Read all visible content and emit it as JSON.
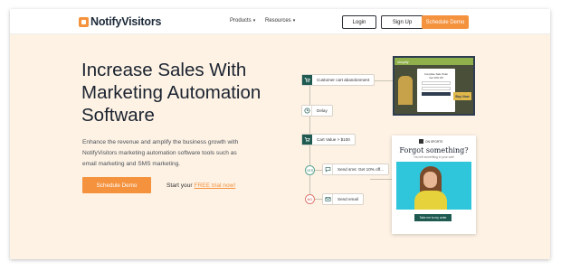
{
  "nav": {
    "brand": "NotifyVisitors",
    "products": "Products",
    "resources": "Resources",
    "login": "Login",
    "signup": "Sign Up",
    "schedule_demo": "Schedule Demo"
  },
  "hero": {
    "title_line1": "Increase Sales With",
    "title_line2": "Marketing Automation",
    "title_line3": "Software",
    "desc_line1": "Enhance the revenue and amplify the business growth with",
    "desc_line2": "NotifyVisitors marketing automation software tools such as",
    "desc_line3": "email marketing and SMS marketing.",
    "cta": "Schedule Demo",
    "trial_prefix": "Start your ",
    "trial_link": "FREE trial now!"
  },
  "workflow": {
    "steps": [
      {
        "label": "Customer cart abandonment",
        "icon": "cart-icon"
      },
      {
        "label": "Delay",
        "icon": "clock-icon"
      },
      {
        "label": "Cart Value > $100",
        "icon": "cart-icon"
      },
      {
        "label": "Send sms: Get 10% off...",
        "icon": "chat-icon"
      },
      {
        "label": "Send email",
        "icon": "mail-icon"
      }
    ],
    "yes": "YES",
    "no": "NO"
  },
  "shop_preview": {
    "brand": "shopify",
    "popup_line1": "Complete Sale Order",
    "popup_line2": "Get 10% Off",
    "buy_now": "Buy Now"
  },
  "email_preview": {
    "brand": "ON SPORTS",
    "title_line1": "Forgot something?",
    "subtitle": "You left something in your cart!",
    "button": "Take me to my order"
  },
  "colors": {
    "accent": "#f5923e",
    "background": "#fdf2e4",
    "teal": "#1e5a50"
  }
}
